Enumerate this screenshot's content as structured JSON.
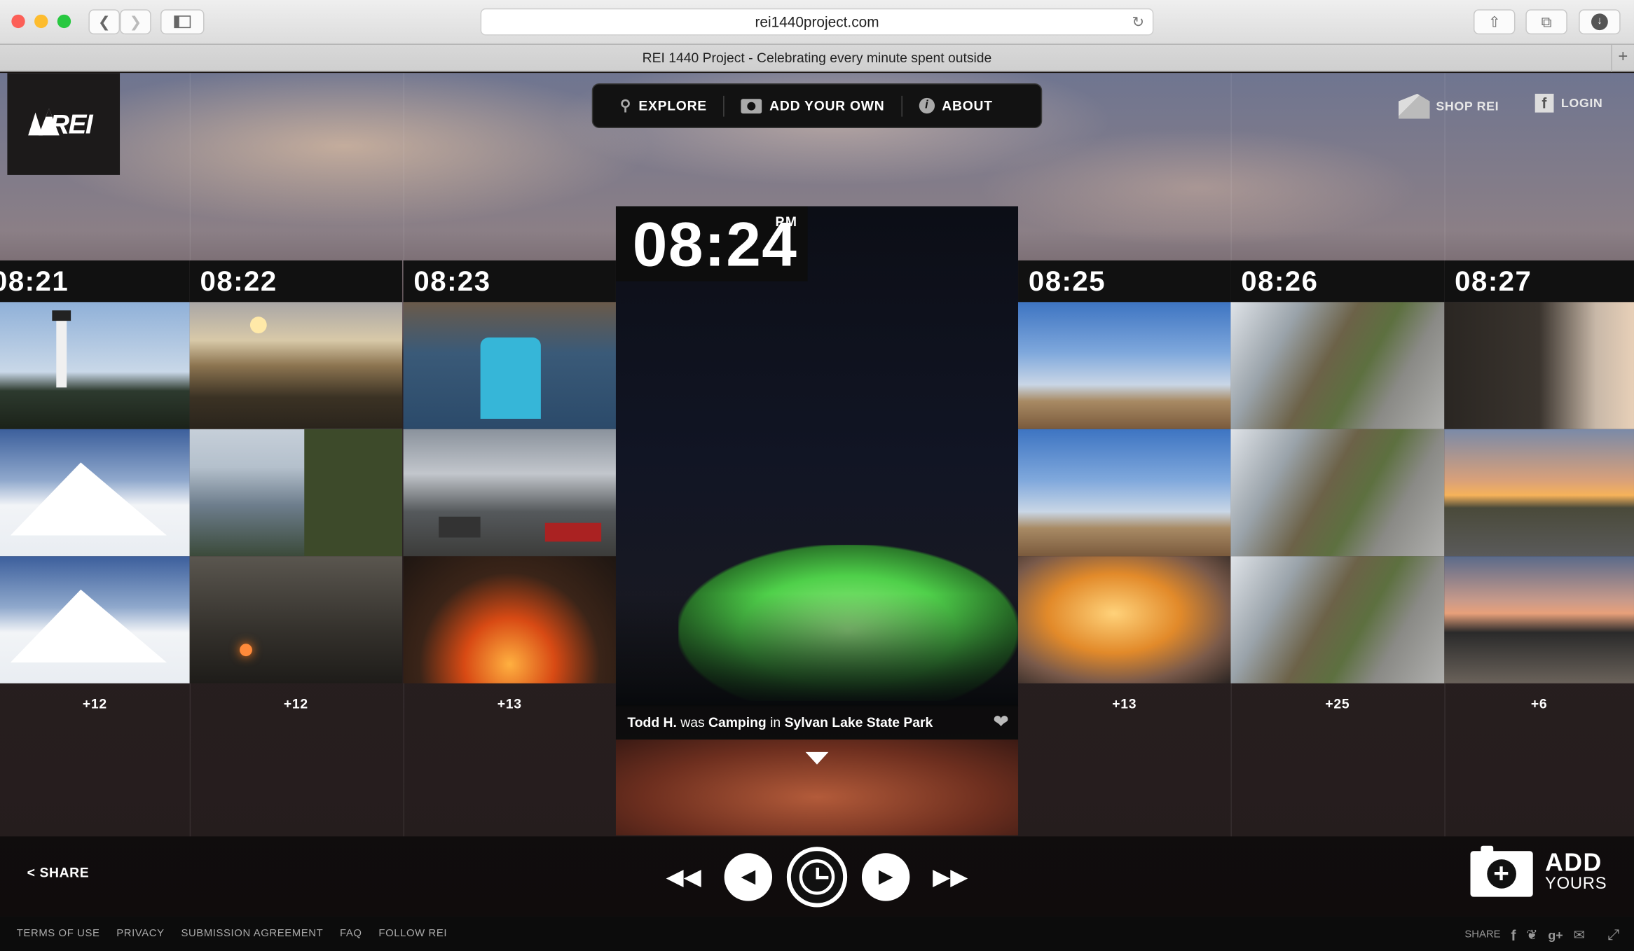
{
  "browser": {
    "url": "rei1440project.com",
    "tab_title": "REI 1440 Project - Celebrating every minute spent outside",
    "tab_plus": "+"
  },
  "brand": {
    "logo": "REI",
    "accent": "#66cc44"
  },
  "nav": {
    "explore": "EXPLORE",
    "add_your_own": "ADD YOUR OWN",
    "about": "ABOUT",
    "shop": "SHOP REI",
    "login": "LOGIN"
  },
  "columns": [
    {
      "time": "08:21",
      "more": "+12"
    },
    {
      "time": "08:22",
      "more": "+12"
    },
    {
      "time": "08:23",
      "more": "+13"
    },
    {
      "time": "08:25",
      "more": "+13"
    },
    {
      "time": "08:26",
      "more": "+25"
    },
    {
      "time": "08:27",
      "more": "+6"
    }
  ],
  "featured": {
    "time": "08:24",
    "ampm": "PM",
    "user": "Todd H.",
    "was": "was",
    "activity": "Camping",
    "in": "in",
    "place": "Sylvan Lake State Park"
  },
  "bottom": {
    "share": "SHARE",
    "add": "ADD",
    "yours": "YOURS"
  },
  "footer": {
    "links": [
      "TERMS OF USE",
      "PRIVACY",
      "SUBMISSION AGREEMENT",
      "FAQ",
      "FOLLOW REI"
    ],
    "share": "SHARE"
  }
}
